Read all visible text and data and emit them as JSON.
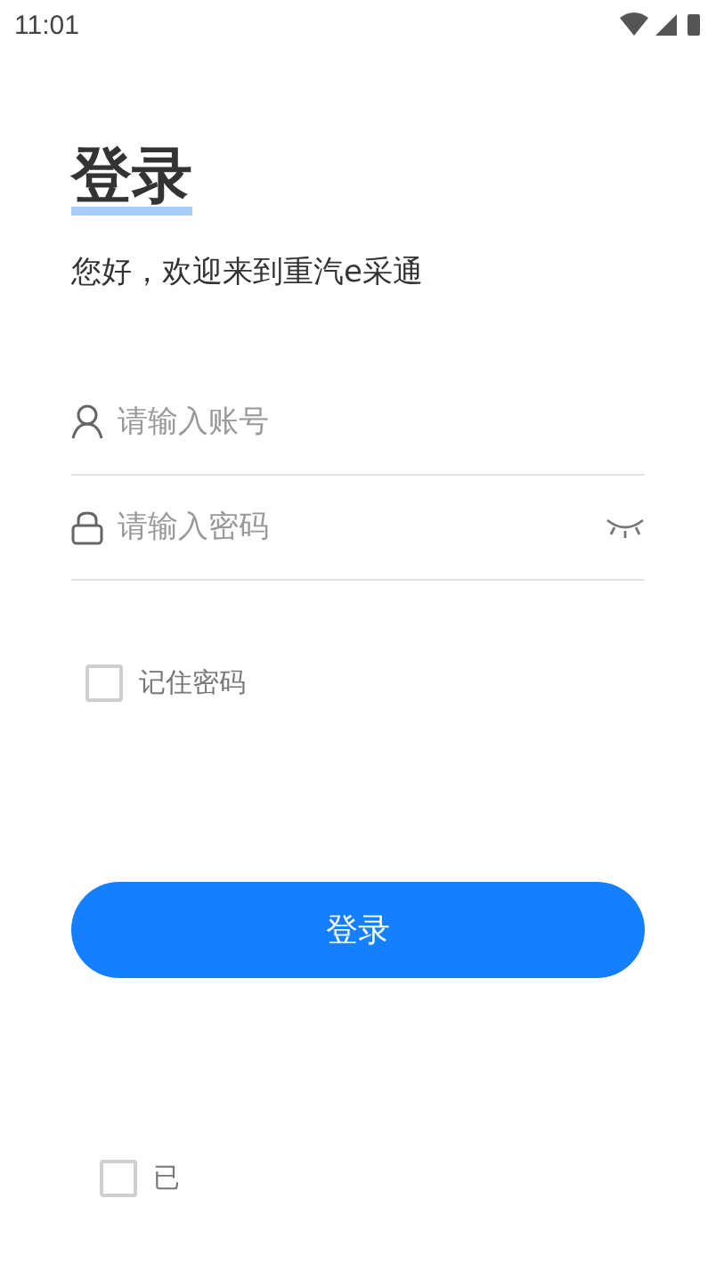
{
  "status_bar": {
    "time": "11:01"
  },
  "title": "登录",
  "subtitle": "您好，欢迎来到重汽e采通",
  "fields": [
    {
      "kind": "account",
      "placeholder": "请输入账号"
    },
    {
      "kind": "password",
      "placeholder": "请输入密码"
    }
  ],
  "remember": {
    "label": "记住密码",
    "checked": false
  },
  "login_button": "登录",
  "agreement": {
    "label": "已",
    "checked": false
  }
}
